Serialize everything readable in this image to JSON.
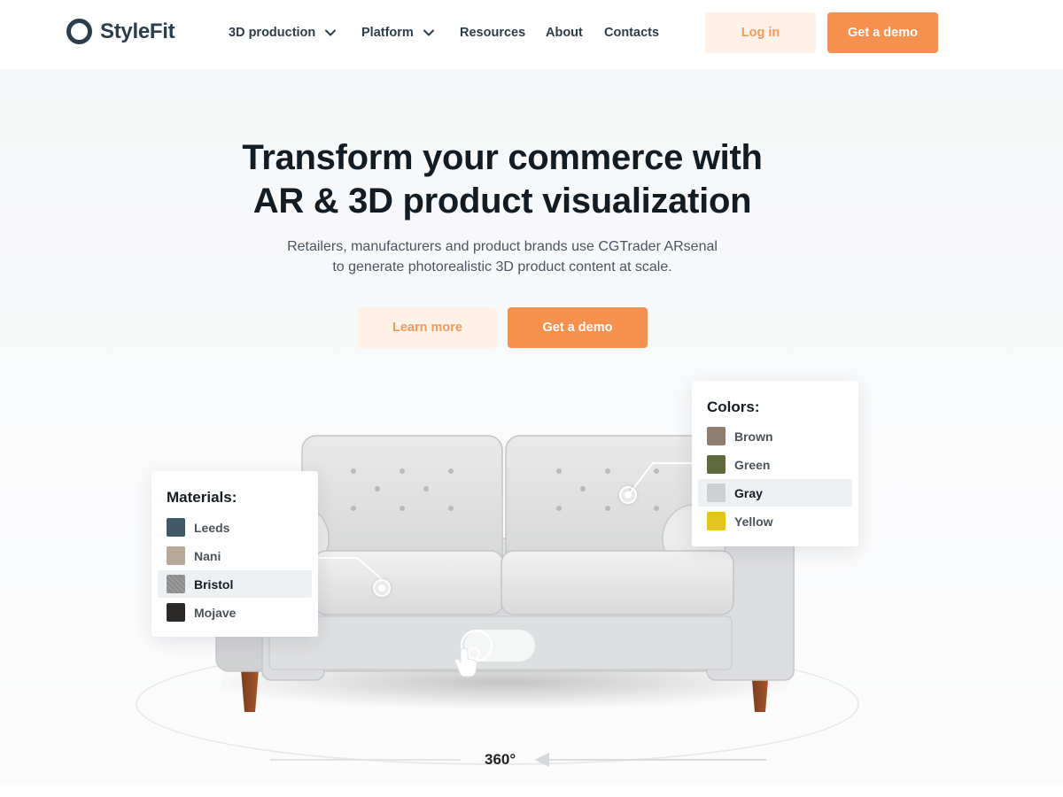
{
  "brand": {
    "name": "StyleFit"
  },
  "nav": {
    "items": [
      {
        "label": "3D production",
        "has_dropdown": true
      },
      {
        "label": "Platform",
        "has_dropdown": true
      },
      {
        "label": "Resources",
        "has_dropdown": false
      },
      {
        "label": "About",
        "has_dropdown": false
      },
      {
        "label": "Contacts",
        "has_dropdown": false
      }
    ],
    "login_label": "Log in",
    "demo_label": "Get a demo"
  },
  "hero": {
    "title_line1": "Transform your commerce with",
    "title_line2": "AR & 3D product visualization",
    "subtitle_line1": "Retailers, manufacturers and product brands use CGTrader ARsenal",
    "subtitle_line2": "to generate photorealistic 3D product content at scale.",
    "learn_more_label": "Learn more",
    "demo_label": "Get a demo"
  },
  "materials": {
    "title": "Materials:",
    "options": [
      {
        "label": "Leeds",
        "color": "#3f5a66",
        "selected": false
      },
      {
        "label": "Nani",
        "color": "#b8a897",
        "selected": false
      },
      {
        "label": "Bristol",
        "color": "#8e8e8e",
        "selected": true
      },
      {
        "label": "Mojave",
        "color": "#2b2a28",
        "selected": false
      }
    ]
  },
  "colors": {
    "title": "Colors:",
    "options": [
      {
        "label": "Brown",
        "color": "#8f7e6f",
        "selected": false
      },
      {
        "label": "Green",
        "color": "#5f6a3e",
        "selected": false
      },
      {
        "label": "Gray",
        "color": "#cdcfd1",
        "selected": true
      },
      {
        "label": "Yellow",
        "color": "#e3c51d",
        "selected": false
      }
    ]
  },
  "viewer": {
    "rotation_label": "360°"
  },
  "theme": {
    "accent": "#f5904f",
    "accent_soft": "#fdf1e8",
    "dark": "#2c3e4c"
  }
}
